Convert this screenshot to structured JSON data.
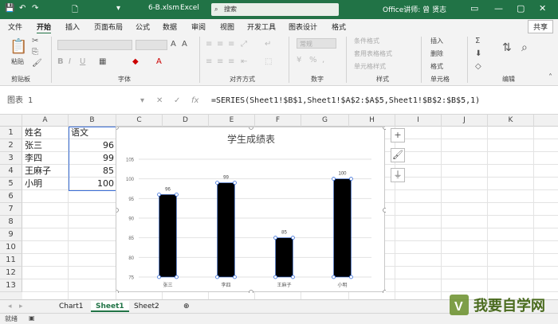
{
  "title_bar": {
    "filename": "6-B.xlsm",
    "app": "Excel",
    "search_placeholder": "搜索",
    "user": "Office讲师: 曾 贤志"
  },
  "ribbon_tabs": [
    "文件",
    "开始",
    "插入",
    "页面布局",
    "公式",
    "数据",
    "审阅",
    "视图",
    "开发工具",
    "图表设计",
    "格式"
  ],
  "share_label": "共享",
  "ribbon": {
    "paste": "粘贴",
    "groups": [
      "剪贴板",
      "字体",
      "对齐方式",
      "数字",
      "样式",
      "单元格",
      "编辑"
    ],
    "number_format": "常规",
    "styles_items": [
      "条件格式",
      "套用表格格式",
      "单元格样式"
    ],
    "cells_items": [
      "插入",
      "删除",
      "格式"
    ]
  },
  "formula_bar": {
    "name_box": "图表 1",
    "formula": "=SERIES(Sheet1!$B$1,Sheet1!$A$2:$A$5,Sheet1!$B$2:$B$5,1)"
  },
  "columns": [
    "A",
    "B",
    "C",
    "D",
    "E",
    "F",
    "G",
    "H",
    "I",
    "J",
    "K"
  ],
  "rows": [
    "1",
    "2",
    "3",
    "4",
    "5",
    "6",
    "7",
    "8",
    "9",
    "10",
    "11",
    "12",
    "13"
  ],
  "cells": {
    "A1": "姓名",
    "B1": "语文",
    "A2": "张三",
    "B2": "96",
    "A3": "李四",
    "B3": "99",
    "A4": "王麻子",
    "B4": "85",
    "A5": "小明",
    "B5": "100"
  },
  "chart_data": {
    "type": "bar",
    "title": "学生成绩表",
    "categories": [
      "张三",
      "李四",
      "王麻子",
      "小明"
    ],
    "values": [
      96,
      99,
      85,
      100
    ],
    "ylim": [
      75,
      105
    ],
    "yticks": [
      75,
      80,
      85,
      90,
      95,
      100,
      105
    ],
    "bar_color": "#000000",
    "grid": true
  },
  "chart_side_buttons": [
    "plus-icon",
    "brush-icon",
    "filter-icon"
  ],
  "sheet_tabs": [
    "Chart1",
    "Sheet1",
    "Sheet2"
  ],
  "active_sheet": "Sheet1",
  "status": "就绪",
  "watermark": "我要自学网",
  "colors": {
    "accent": "#217346",
    "selection": "#3b6fd9"
  }
}
